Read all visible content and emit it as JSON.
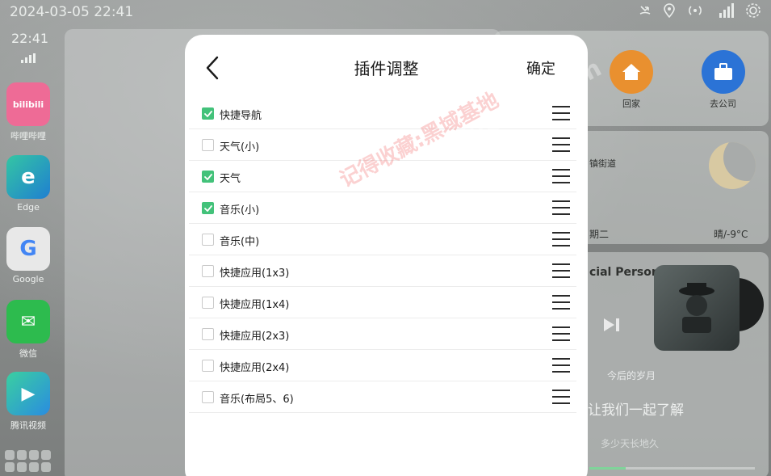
{
  "status_bar": {
    "datetime": "2024-03-05 22:41",
    "icons": [
      "call-missed-icon",
      "location-icon",
      "hotspot-icon",
      "signal-4g-icon",
      "settings-icon"
    ]
  },
  "dock": {
    "time": "22:41",
    "apps": [
      {
        "label": "哔哩哔哩",
        "icon_text": "bilibili",
        "color": "#f06292"
      },
      {
        "label": "Edge",
        "icon_text": "e",
        "color": "#1e88c9"
      },
      {
        "label": "Google",
        "icon_text": "G",
        "color": "#e6e6e6"
      },
      {
        "label": "微信",
        "icon_text": "✉",
        "color": "#2dbb4e"
      },
      {
        "label": "腾讯视频",
        "icon_text": "▶",
        "color": "#2a8ce0"
      }
    ]
  },
  "widgets": {
    "nav": {
      "home_label": "回家",
      "office_label": "去公司"
    },
    "weather": {
      "location": "镇街道",
      "day": "期二",
      "condition": "晴/-9°C"
    },
    "music": {
      "title": "cial Person)",
      "subtitle": "今后的岁月",
      "lyric": "让我们一起了解",
      "lyric2": "多少天长地久",
      "progress": 0.22
    }
  },
  "watermark": {
    "text": "记得收藏:黑域基地",
    "text2": "Hybase.com"
  },
  "modal": {
    "title": "插件调整",
    "confirm_label": "确定",
    "items": [
      {
        "label": "快捷导航",
        "checked": true
      },
      {
        "label": "天气(小)",
        "checked": false
      },
      {
        "label": "天气",
        "checked": true
      },
      {
        "label": "音乐(小)",
        "checked": true
      },
      {
        "label": "音乐(中)",
        "checked": false
      },
      {
        "label": "快捷应用(1x3)",
        "checked": false
      },
      {
        "label": "快捷应用(1x4)",
        "checked": false
      },
      {
        "label": "快捷应用(2x3)",
        "checked": false
      },
      {
        "label": "快捷应用(2x4)",
        "checked": false
      },
      {
        "label": "音乐(布局5、6)",
        "checked": false
      }
    ]
  },
  "colors": {
    "accent": "#43c27a"
  }
}
